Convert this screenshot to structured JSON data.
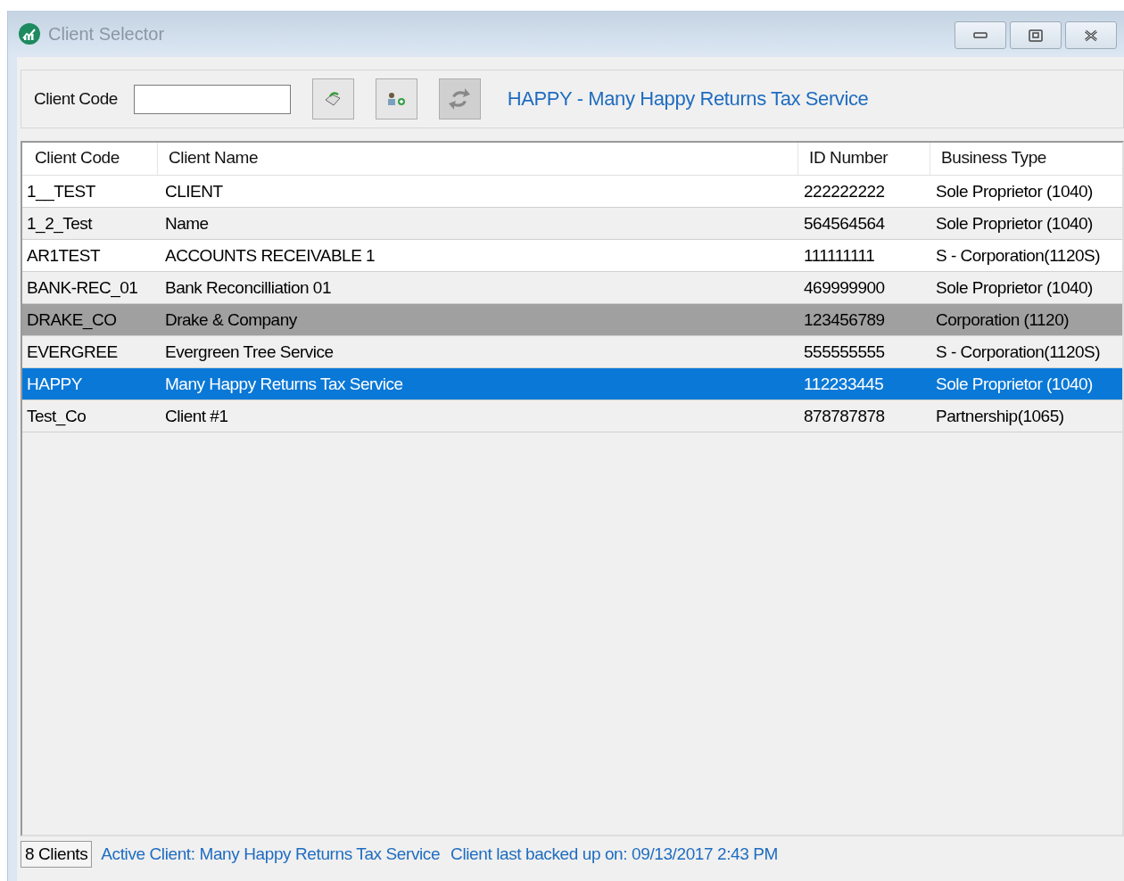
{
  "window": {
    "title": "Client Selector"
  },
  "toolbar": {
    "label": "Client Code",
    "current_client": "HAPPY - Many Happy Returns Tax Service"
  },
  "table": {
    "columns": [
      "Client Code",
      "Client Name",
      "ID Number",
      "Business Type"
    ],
    "rows": [
      {
        "cells": [
          "1__TEST",
          "CLIENT",
          "222222222",
          "Sole Proprietor (1040)"
        ],
        "selected": false,
        "highlighted": false
      },
      {
        "cells": [
          "1_2_Test",
          "Name",
          "564564564",
          "Sole Proprietor (1040)"
        ],
        "selected": false,
        "highlighted": false
      },
      {
        "cells": [
          "AR1TEST",
          "ACCOUNTS RECEIVABLE 1",
          "111111111",
          "S - Corporation(1120S)"
        ],
        "selected": false,
        "highlighted": false
      },
      {
        "cells": [
          "BANK-REC_01",
          "Bank Reconcilliation 01",
          "469999900",
          "Sole Proprietor (1040)"
        ],
        "selected": false,
        "highlighted": false
      },
      {
        "cells": [
          "DRAKE_CO",
          "Drake & Company",
          "123456789",
          "Corporation (1120)"
        ],
        "selected": false,
        "highlighted": true
      },
      {
        "cells": [
          "EVERGREE",
          "Evergreen Tree Service",
          "555555555",
          "S - Corporation(1120S)"
        ],
        "selected": false,
        "highlighted": false
      },
      {
        "cells": [
          "HAPPY",
          "Many Happy Returns Tax Service",
          "112233445",
          "Sole Proprietor (1040)"
        ],
        "selected": true,
        "highlighted": false
      },
      {
        "cells": [
          "Test_Co",
          "Client #1",
          "878787878",
          "Partnership(1065)"
        ],
        "selected": false,
        "highlighted": false
      }
    ]
  },
  "status_bar": {
    "count": "8 Clients",
    "active_client": "Active Client: Many Happy Returns Tax Service",
    "backup": "Client last backed up on: 09/13/2017 2:43 PM"
  }
}
